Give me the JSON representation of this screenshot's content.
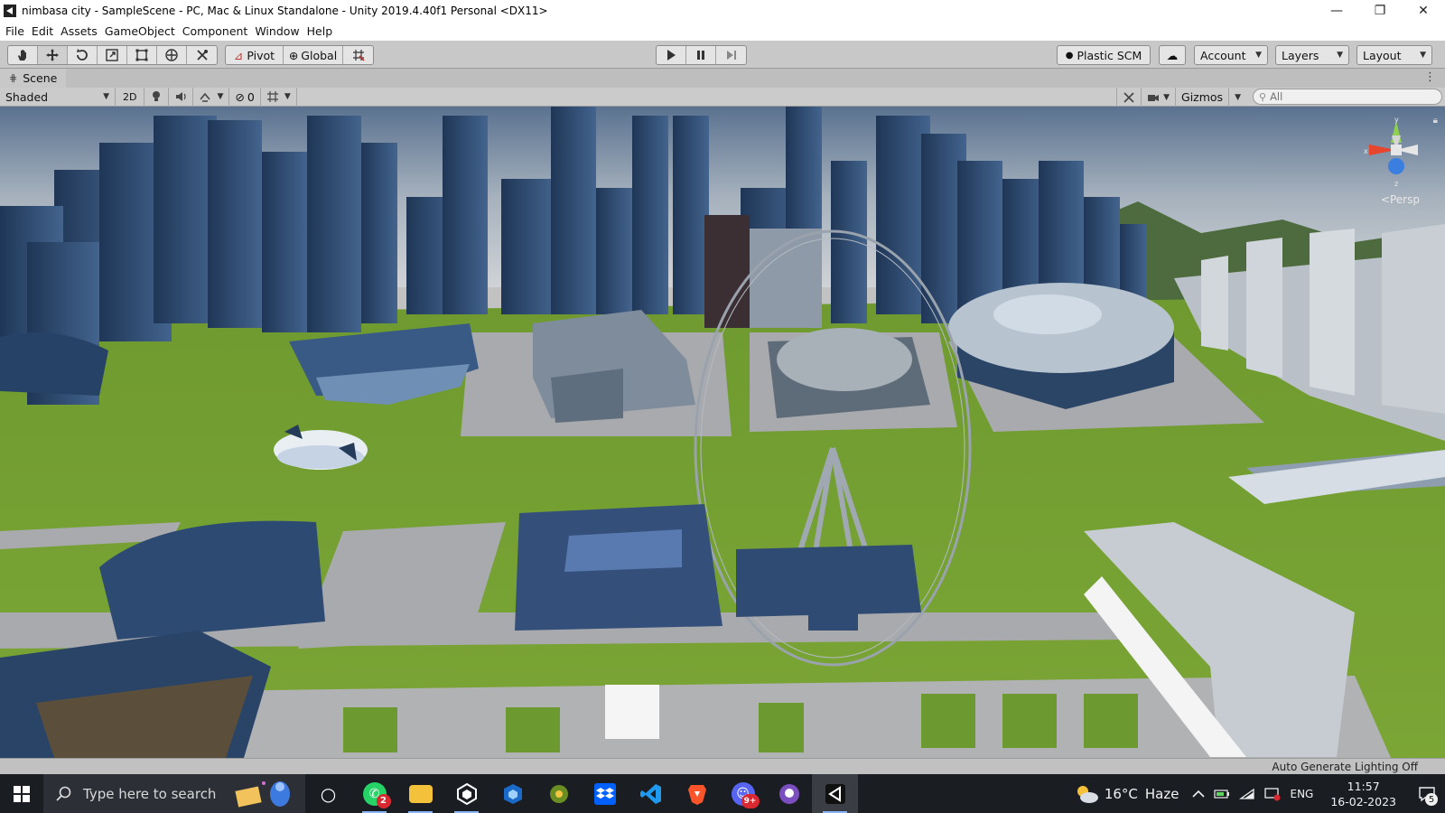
{
  "window": {
    "title": "nimbasa city - SampleScene - PC, Mac & Linux Standalone - Unity 2019.4.40f1 Personal <DX11>",
    "controls": {
      "minimize": "—",
      "restore": "❐",
      "close": "✕"
    }
  },
  "menu": [
    "File",
    "Edit",
    "Assets",
    "GameObject",
    "Component",
    "Window",
    "Help"
  ],
  "toolbar": {
    "tools": [
      "hand-tool",
      "move-tool",
      "rotate-tool",
      "scale-tool",
      "rect-tool",
      "transform-tool",
      "custom-tool"
    ],
    "pivot_label": "Pivot",
    "global_label": "Global",
    "play_controls": [
      "play",
      "pause",
      "step"
    ],
    "plastic_scm_label": "Plastic SCM",
    "account_label": "Account",
    "layers_label": "Layers",
    "layout_label": "Layout"
  },
  "scene_tab": {
    "label": "Scene"
  },
  "scene_toolbar": {
    "shading_mode": "Shaded",
    "mode_2d": "2D",
    "hidden_count": "0",
    "gizmos_label": "Gizmos",
    "search_placeholder": "All"
  },
  "viewport": {
    "projection": "<Persp",
    "gizmo_axes": {
      "y": "y",
      "x": "x",
      "z": "z"
    },
    "colors": {
      "sky_top": "#5f7591",
      "sky_horizon": "#c9cdd1",
      "grass": "#6f9b2e",
      "road": "#a9aaad",
      "building_dark": "#2a4467",
      "building_mid": "#3e5c82"
    }
  },
  "status": {
    "text": "Auto Generate Lighting Off"
  },
  "taskbar": {
    "search_placeholder": "Type here to search",
    "apps": [
      {
        "name": "cortana",
        "glyph": "○",
        "badge": ""
      },
      {
        "name": "whatsapp",
        "glyph": "✆",
        "badge": "2",
        "color": "#25d366"
      },
      {
        "name": "file-explorer",
        "glyph": "▬",
        "badge": "",
        "color": "#f3c13a"
      },
      {
        "name": "unity-hub",
        "glyph": "◈",
        "badge": "",
        "color": "#2b2b2b"
      },
      {
        "name": "virtualbox",
        "glyph": "⬡",
        "badge": "",
        "color": "#1b6ac9"
      },
      {
        "name": "git-tool",
        "glyph": "◉",
        "badge": "",
        "color": "#6b8e23"
      },
      {
        "name": "dropbox",
        "glyph": "❖",
        "badge": "",
        "color": "#0061fe"
      },
      {
        "name": "vscode",
        "glyph": "≺",
        "badge": "",
        "color": "#0a7acc"
      },
      {
        "name": "brave",
        "glyph": "▼",
        "badge": "",
        "color": "#fb542b"
      },
      {
        "name": "discord",
        "glyph": "☺",
        "badge": "9+",
        "color": "#5865f2"
      },
      {
        "name": "github-desktop",
        "glyph": "◐",
        "badge": "",
        "color": "#7b4fbf"
      },
      {
        "name": "unity-editor",
        "glyph": "◁",
        "badge": "",
        "color": "#222222"
      }
    ],
    "weather": {
      "temp": "16°C",
      "condition": "Haze"
    },
    "language": "ENG",
    "time": "11:57",
    "date": "16-02-2023",
    "notifications": "5"
  }
}
